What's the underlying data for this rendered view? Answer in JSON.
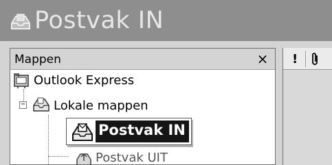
{
  "window": {
    "title": "Postvak IN",
    "icon": "inbox-tray-icon"
  },
  "folder_pane": {
    "header_label": "Mappen",
    "close_label": "×",
    "items": [
      {
        "label": "Outlook Express",
        "icon": "outlook-express-icon",
        "level": 0
      },
      {
        "label": "Lokale mappen",
        "icon": "local-folders-icon",
        "level": 1,
        "expanded": true
      },
      {
        "label": "Postvak IN",
        "icon": "inbox-icon",
        "level": 2,
        "selected": true
      },
      {
        "label": "Postvak UIT",
        "icon": "outbox-icon",
        "level": 2
      }
    ]
  },
  "message_list": {
    "columns": [
      {
        "label": "!",
        "name": "priority"
      },
      {
        "label": "",
        "name": "attachment",
        "icon": "paperclip-icon"
      }
    ]
  },
  "colors": {
    "titlebar": "#8e8e8e",
    "title_text": "#e7e7e7",
    "selected_bg": "#151515",
    "selected_text": "#ffffff"
  }
}
